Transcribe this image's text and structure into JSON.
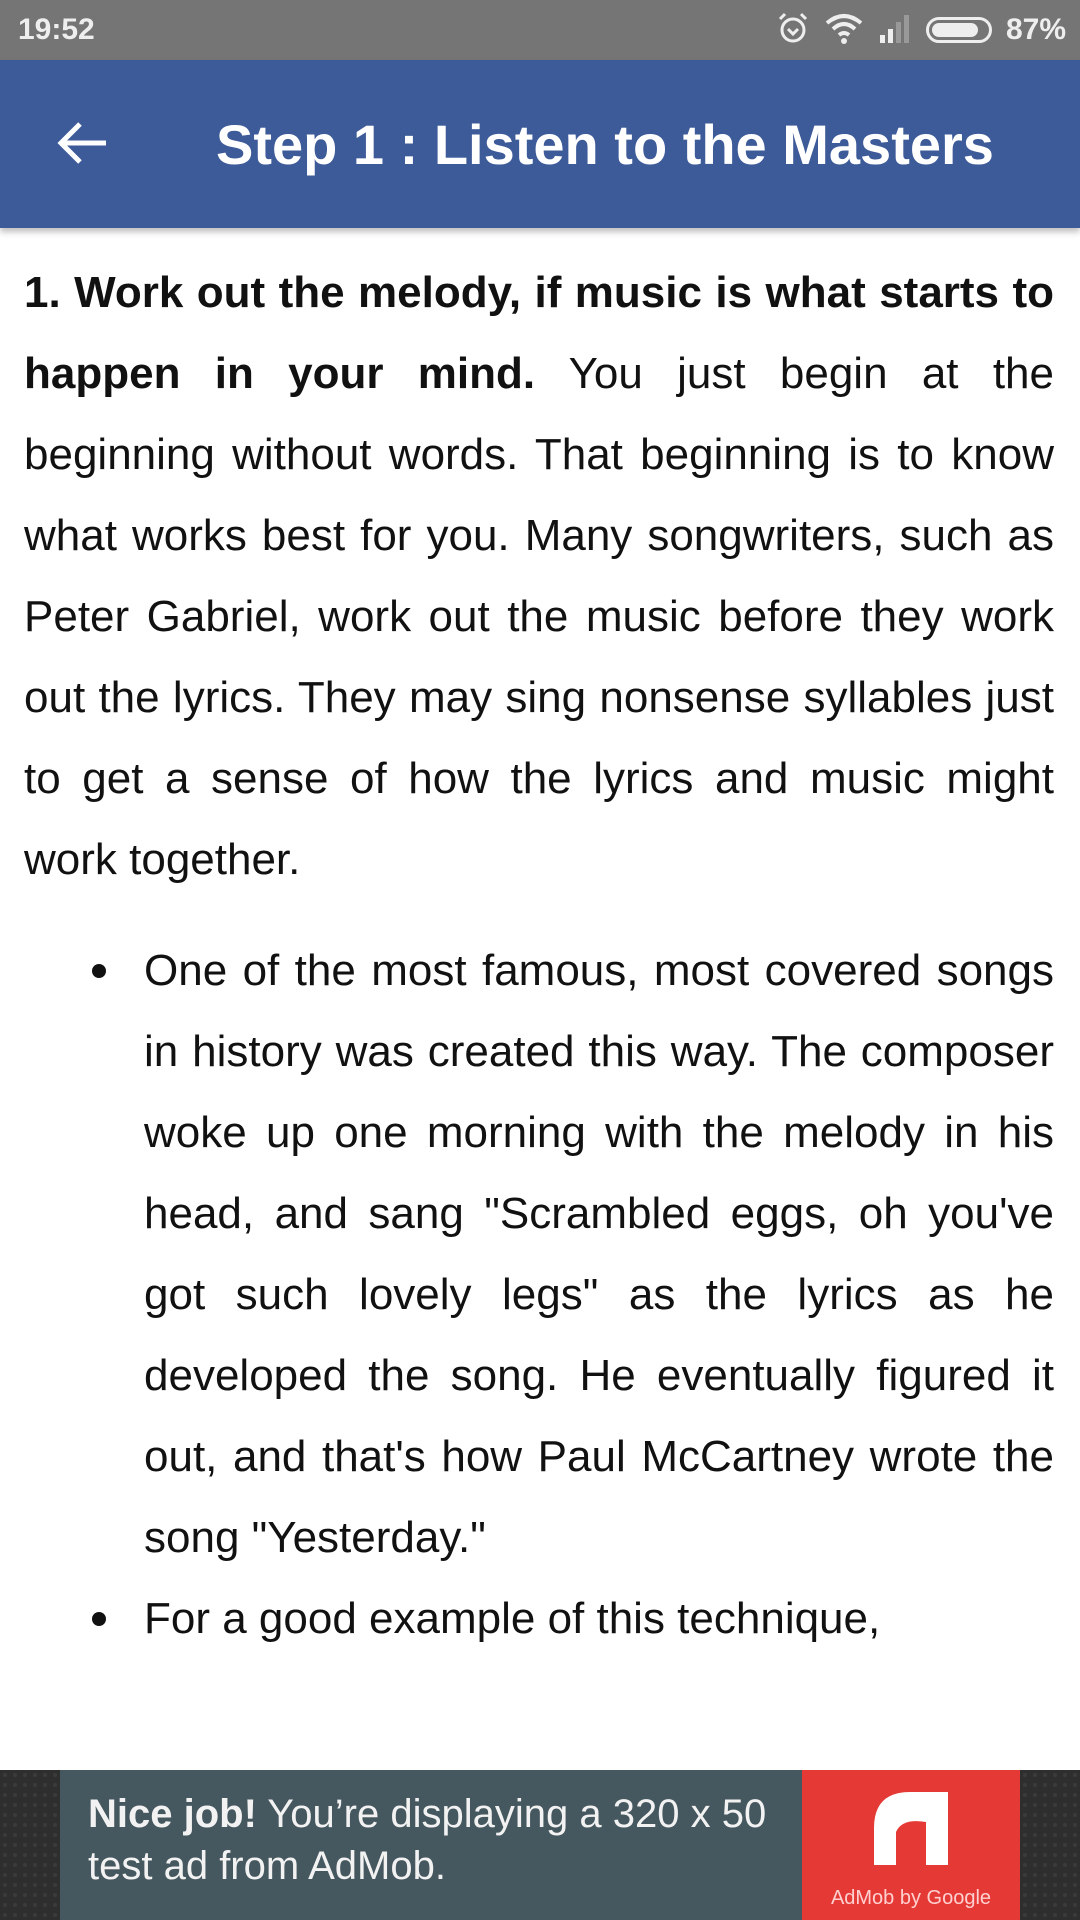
{
  "status_bar": {
    "time": "19:52",
    "battery_percent": "87%",
    "battery_level": 0.87,
    "icons": [
      "alarm-icon",
      "wifi-icon",
      "signal-icon",
      "battery-icon"
    ]
  },
  "app_bar": {
    "back_icon": "arrow-left-icon",
    "title": "Step 1 : Listen to the Masters",
    "color": "#3d5a99"
  },
  "article": {
    "intro_bold": "1. Work out the melody, if music is what starts to happen in your mind.",
    "intro_text": " You just begin at the beginning without words. That beginning is to know what works best for you. Many songwriters, such as Peter Gabriel, work out the music before they work out the lyrics. They may sing nonsense syllables just to get a sense of how the lyrics and music might work together.",
    "bullets": [
      "One of the most famous, most covered songs in history was created this way. The composer woke up one morning with the melody in his head, and sang \"Scrambled eggs, oh you've got such lovely legs\" as the lyrics as he developed the song. He eventually figured it out, and that's how Paul McCartney wrote the song \"Yesterday.\"",
      "For a good example of this technique,"
    ]
  },
  "ad": {
    "headline": "Nice job!",
    "body": " You’re displaying a 320 x 50 test ad from AdMob.",
    "logo_caption": "AdMob by Google",
    "logo_color": "#e53935"
  }
}
